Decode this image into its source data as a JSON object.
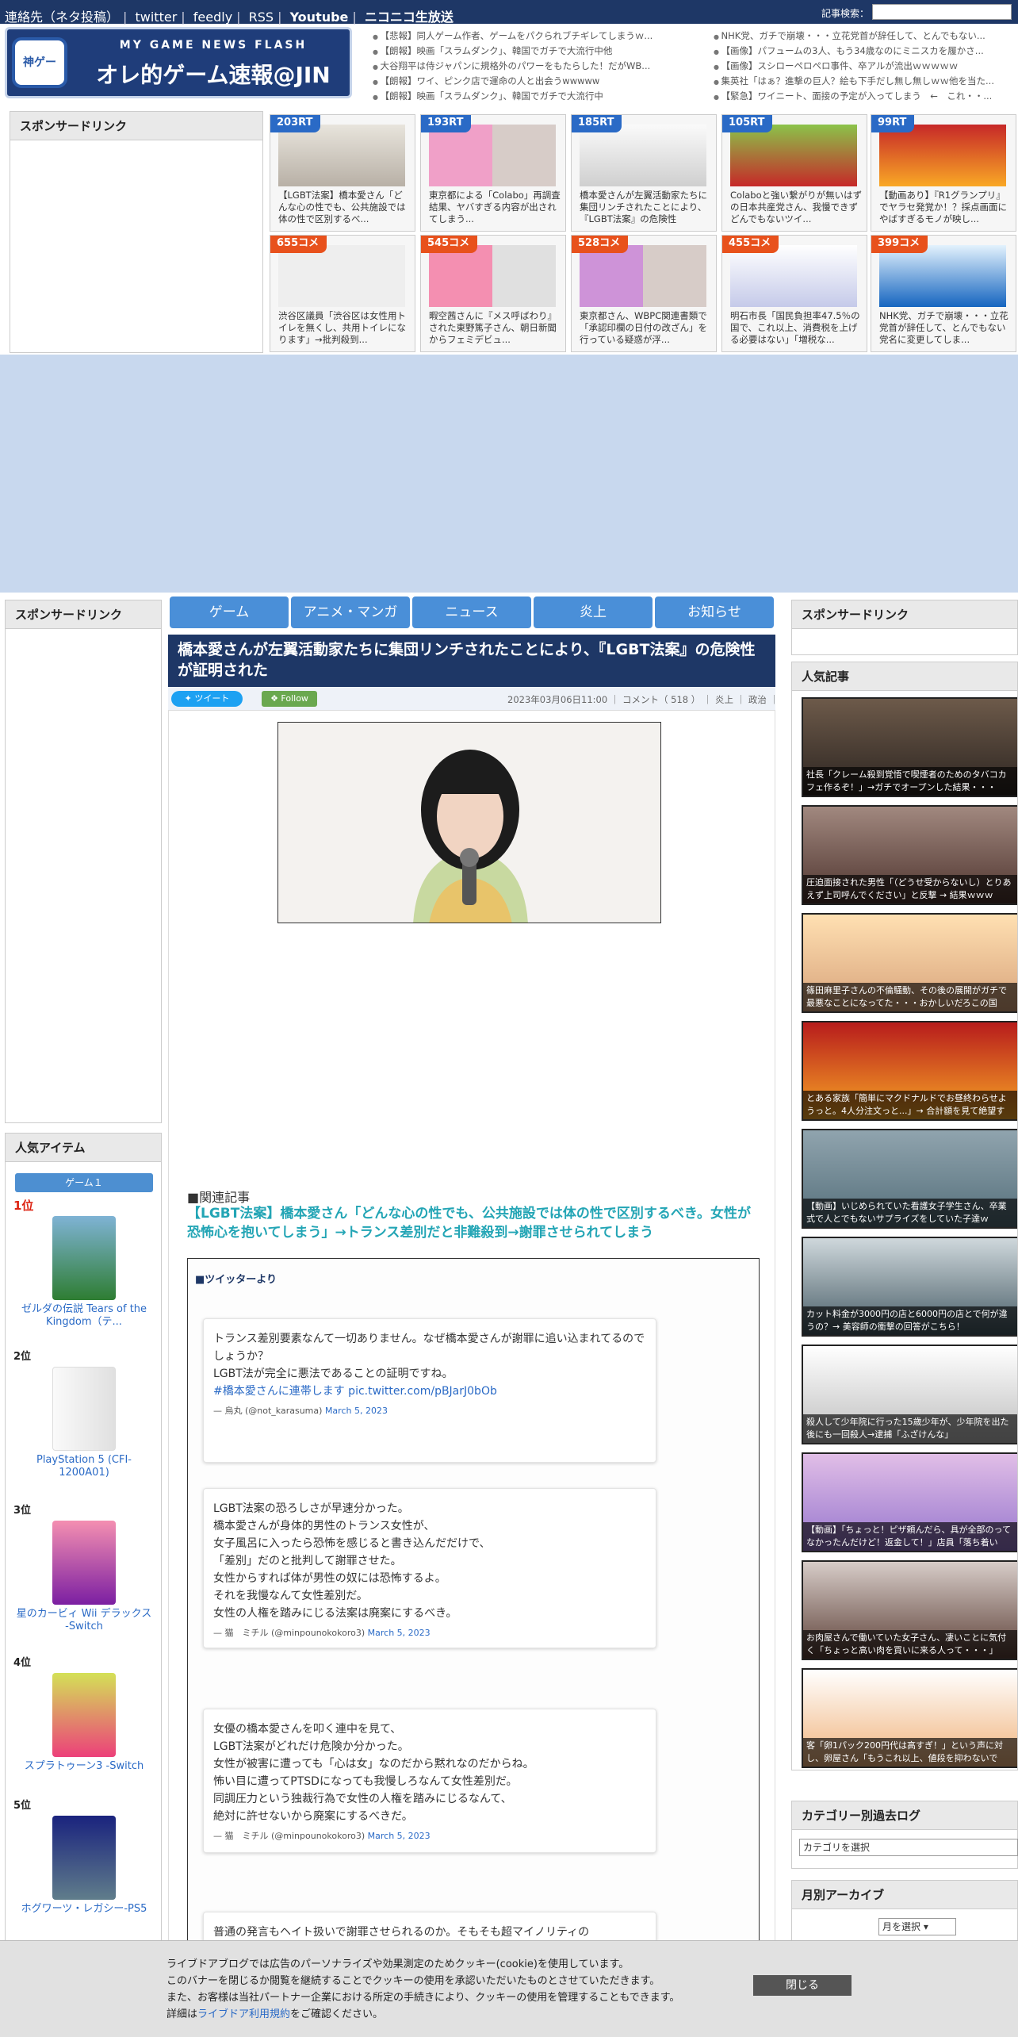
{
  "topnav": {
    "items": [
      "連絡先（ネタ投稿）",
      "twitter",
      "feedly",
      "RSS",
      "Youtube",
      "ニコニコ生放送"
    ],
    "search_label": "記事検索："
  },
  "header": {
    "logo_sub": "MY GAME NEWS FLASH",
    "logo_main": "オレ的ゲーム速報@JIN",
    "logo_face": "神ゲー",
    "headlines_left": [
      "【悲報】同人ゲーム作者、ゲームをパクられブチギレてしまうｗ...",
      "【朗報】映画「スラムダンク」、韓国でガチで大流行中他",
      "大谷翔平は侍ジャパンに規格外のパワーをもたらした！だがWB...",
      "【朗報】ワイ、ピンク店で運命の人と出会うwwwww",
      "【朗報】映画「スラムダンク」、韓国でガチで大流行中"
    ],
    "headlines_right": [
      "NHK党、ガチで崩壊・・・立花党首が辞任して、とんでもない...",
      "【画像】パフュームの3人、もう34歳なのにミニスカを履かさ...",
      "【画像】スシローペロペロ事件、卒アルが流出ｗｗｗｗｗ",
      "集英社「はぁ？進撃の巨人？絵も下手だし無し無しｗｗ他を当た...",
      "【緊急】ワイニート、面接の予定が入ってしまう　←　これ・・..."
    ]
  },
  "sponsored_label": "スポンサードリンク",
  "thumbs": [
    {
      "badge": "203RT",
      "caption": "【LGBT法案】橋本愛さん「どんな心の性でも、公共施設では体の性で区別するべ..."
    },
    {
      "badge": "193RT",
      "caption": "東京都による「Colabo」再調査結果、ヤバすぎる内容が出されてしまう..."
    },
    {
      "badge": "185RT",
      "caption": "橋本愛さんが左翼活動家たちに集団リンチされたことにより、『LGBT法案』の危険性"
    },
    {
      "badge": "105RT",
      "caption": "Colaboと強い繋がりが無いはずの日本共産党さん、我慢できずどんでもないツイ..."
    },
    {
      "badge": "99RT",
      "caption": "【動画あり】『R1グランプリ』でヤラセ発覚か！？採点画面にやばすぎるモノが映し..."
    },
    {
      "badge": "655コメ",
      "caption": "渋谷区議員「渋谷区は女性用トイレを無くし、共用トイレになります」→批判殺到..."
    },
    {
      "badge": "545コメ",
      "caption": "暇空茜さんに『メス呼ばわり』された東野篤子さん、朝日新聞からフェミデビュ..."
    },
    {
      "badge": "528コメ",
      "caption": "東京都さん、WBPC関連書類で「承認印欄の日付の改ざん」を行っている疑惑が浮..."
    },
    {
      "badge": "455コメ",
      "caption": "明石市長「国民負担率47.5％の国で、これ以上、消費税を上げる必要はない」「増税な..."
    },
    {
      "badge": "399コメ",
      "caption": "NHK党、ガチで崩壊・・・立花党首が辞任して、とんでもない党名に変更してしま..."
    }
  ],
  "nav": [
    "ゲーム",
    "アニメ・マンガ",
    "ニュース",
    "炎上",
    "お知らせ"
  ],
  "article": {
    "title": "橋本愛さんが左翼活動家たちに集団リンチされたことにより、『LGBT法案』の危険性が証明された",
    "tweet_label": "ツイート",
    "follow_label": "Follow",
    "meta": "2023年03月06日11:00 ｜ コメント（ 518 ） ｜ 炎上 ｜ 政治 ｜",
    "related_head": "■関連記事",
    "related_link": "【LGBT法案】橋本愛さん「どんな心の性でも、公共施設では体の性で区別するべき。女性が恐怖心を抱いてしまう」→トランス差別だと非難殺到→謝罪させられてしまう",
    "twitter_head": "■ツイッターより"
  },
  "tweets": [
    {
      "text": "トランス差別要素なんて一切ありません。なぜ橋本愛さんが謝罪に追い込まれてるのでしょうか？\nLGBT法が完全に悪法であることの証明ですね。",
      "link": "#橋本愛さんに連帯します pic.twitter.com/pBJarJ0bOb",
      "by": "— 烏丸 (@not_karasuma)",
      "date": "March 5, 2023"
    },
    {
      "text": "LGBT法案の恐ろしさが早速分かった。\n橋本愛さんが身体的男性のトランス女性が、\n女子風呂に入ったら恐怖を感じると書き込んだだけで、\n「差別」だのと批判して謝罪させた。\n女性からすれば体が男性の奴には恐怖するよ。\nそれを我慢なんて女性差別だ。\n女性の人権を踏みにじる法案は廃案にするべき。",
      "link": "",
      "by": "— 猫　ミチル (@minpounokokoro3)",
      "date": "March 5, 2023"
    },
    {
      "text": "女優の橋本愛さんを叩く連中を見て、\nLGBT法案がどれだけ危険か分かった。\n女性が被害に遭っても「心は女」なのだから黙れなのだからね。\n怖い目に遭ってPTSDになっても我慢しろなんて女性差別だ。\n同調圧力という独裁行為で女性の人権を踏みにじるなんて、\n絶対に許せないから廃案にするべきだ。",
      "link": "",
      "by": "— 猫　ミチル (@minpounokokoro3)",
      "date": "March 5, 2023"
    },
    {
      "text": "普通の発言もヘイト扱いで謝罪させられるのか。そもそも超マイノリティの",
      "link": "",
      "by": "",
      "date": ""
    }
  ],
  "popular_items": {
    "title": "人気アイテム",
    "tab": "ゲーム１",
    "items": [
      {
        "rank": "1位",
        "name": "ゼルダの伝説 Tears of the Kingdom（テ..."
      },
      {
        "rank": "2位",
        "name": "PlayStation 5 (CFI-1200A01)"
      },
      {
        "rank": "3位",
        "name": "星のカービィ Wii デラックス -Switch"
      },
      {
        "rank": "4位",
        "name": "スプラトゥーン3 -Switch"
      },
      {
        "rank": "5位",
        "name": "ホグワーツ・レガシー-PS5"
      }
    ]
  },
  "popular_articles": {
    "title": "人気記事",
    "items": [
      "社長「クレーム殺到覚悟で喫煙者のためのタバコカフェ作るぞ！」→ガチでオープンした結果・・・",
      "圧迫面接された男性「（どうせ受からないし）とりあえず上司呼んでください」と反撃 → 結果ｗｗｗ",
      "篠田麻里子さんの不倫騒動、その後の展開がガチで最悪なことになってた・・・おかしいだろこの国",
      "とある家族「簡単にマクドナルドでお昼終わらせようっと。4人分注文っと...」→ 合計額を見て絶望す",
      "【動画】いじめられていた看護女子学生さん、卒業式で人とでもないサプライズをしていた子達ｗ",
      "カット料金が3000円の店と6000円の店とで何が違うの？→ 美容師の衝撃の回答がこちら！",
      "殺人して少年院に行った15歳少年が、少年院を出た後にも一回殺人→逮捕「ふざけんな」",
      "【動画】「ちょっと！ピザ頼んだら、具が全部のってなかったんだけど！返金して！」店員「落ち着い",
      "お肉屋さんで働いていた女子さん、凄いことに気付く「ちょっと高い肉を買いに来る人って・・・」",
      "客「卵1パック200円代は高すぎ！」という声に対し、卵屋さん「もうこれ以上、値段を抑わないで"
    ]
  },
  "category": {
    "title": "カテゴリー別過去ログ",
    "select": "カテゴリを選択"
  },
  "archive": {
    "title": "月別アーカイブ",
    "select": "月を選択 ▾"
  },
  "cookie": {
    "line1": "ライブドアブログでは広告のパーソナライズや効果測定のためクッキー(cookie)を使用しています。",
    "line2": "このバナーを閉じるか閲覧を継続することでクッキーの使用を承認いただいたものとさせていただきます。",
    "line3": "また、お客様は当社パートナー企業における所定の手続きにより、クッキーの使用を管理することもできます。",
    "line4_pre": "詳細は",
    "line4_link": "ライブドア利用規約",
    "line4_post": "をご確認ください。",
    "close": "閉じる"
  }
}
